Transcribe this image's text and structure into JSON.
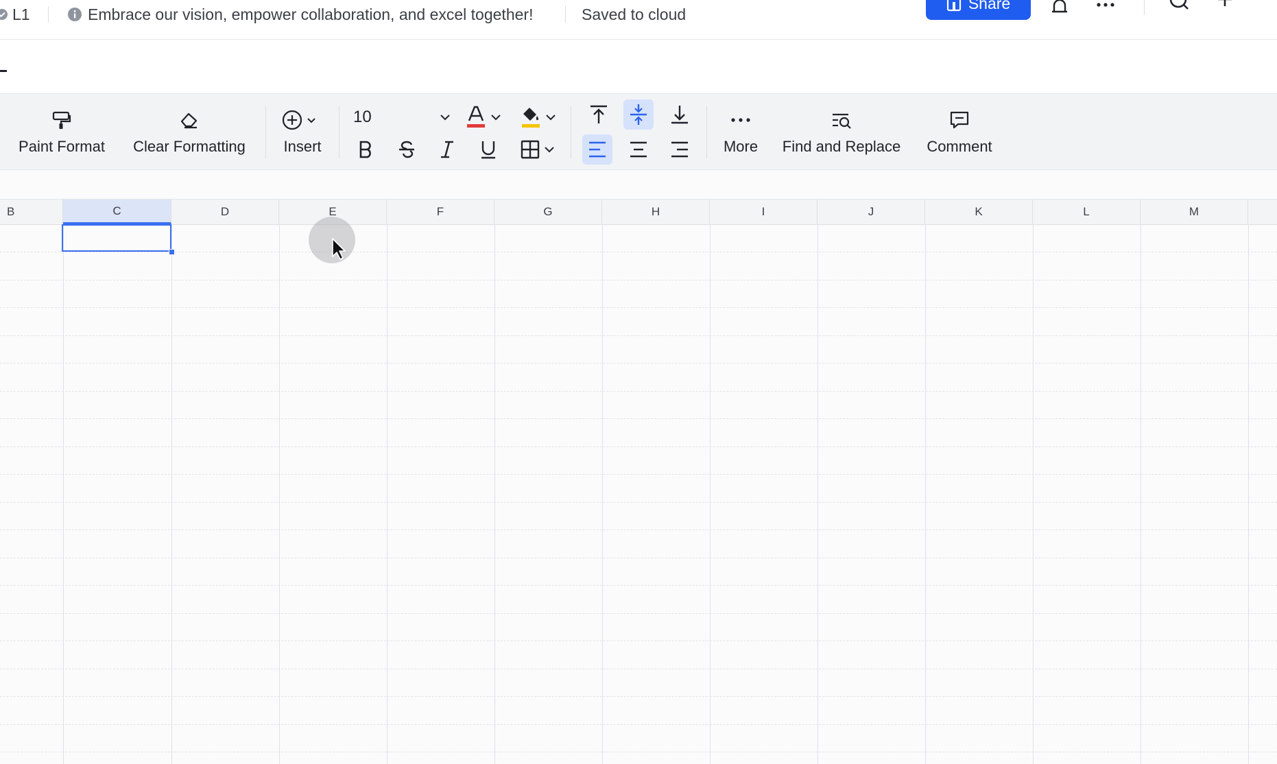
{
  "topbar": {
    "doc_id": "L1",
    "banner_text": "Embrace our vision, empower collaboration, and excel together!",
    "save_status": "Saved to cloud",
    "share_label": "Share"
  },
  "toolbar": {
    "paint_format": "Paint Format",
    "clear_formatting": "Clear Formatting",
    "insert": "Insert",
    "font_size": "10",
    "more": "More",
    "find_replace": "Find and Replace",
    "comment": "Comment"
  },
  "sheet": {
    "columns": [
      "B",
      "C",
      "D",
      "E",
      "F",
      "G",
      "H",
      "I",
      "J",
      "K",
      "L",
      "M"
    ],
    "active_column": "C"
  },
  "colors": {
    "accent": "#1f5cf0",
    "font_color_bar": "#e23b3b",
    "fill_color_bar": "#f5c400",
    "selection": "#3a6ff0"
  }
}
